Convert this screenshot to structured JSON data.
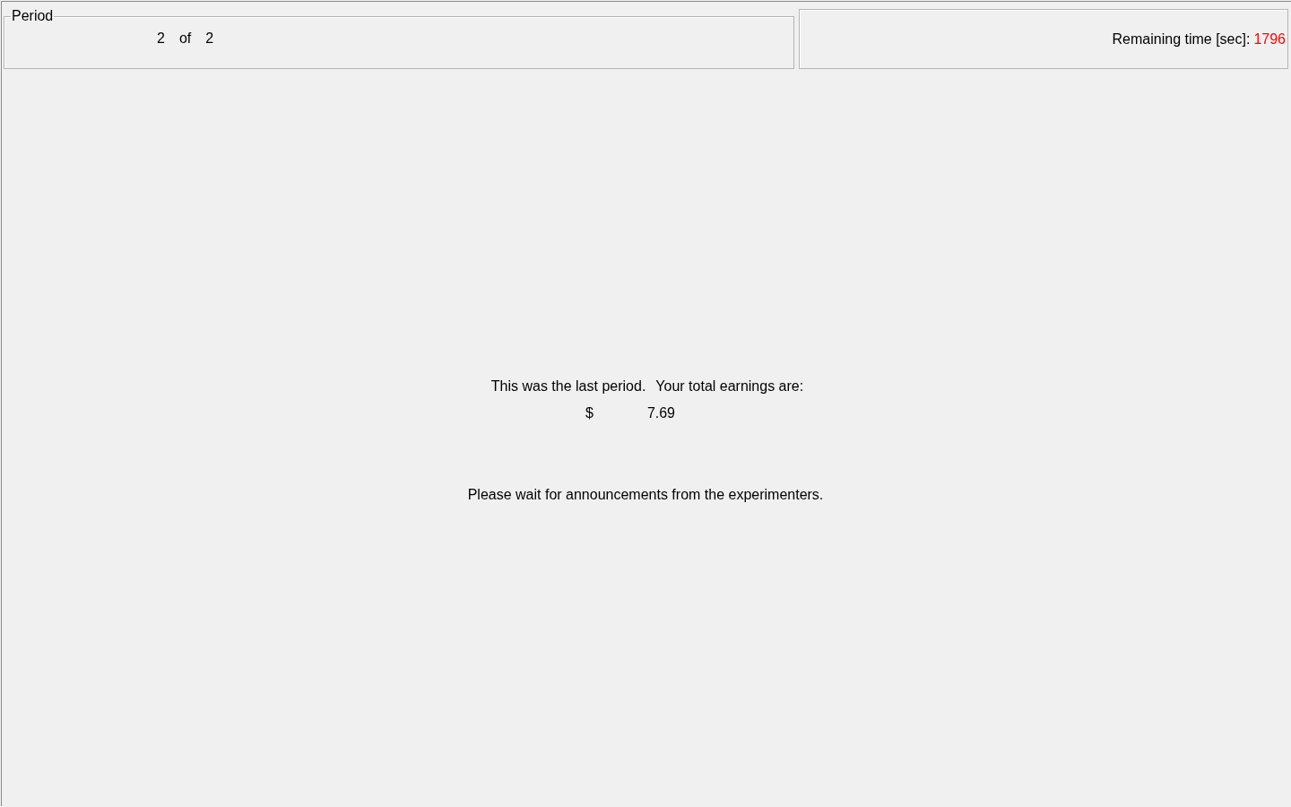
{
  "period_panel": {
    "title": "Period",
    "current": "2",
    "separator": "of",
    "total": "2"
  },
  "timer_panel": {
    "label": "Remaining time [sec]:",
    "value": "1796"
  },
  "results": {
    "sentence_1": "This was the last period.",
    "sentence_2": "Your total earnings are:",
    "currency": "$",
    "amount": "7.69",
    "notice": "Please wait for announcements from the experimenters."
  }
}
